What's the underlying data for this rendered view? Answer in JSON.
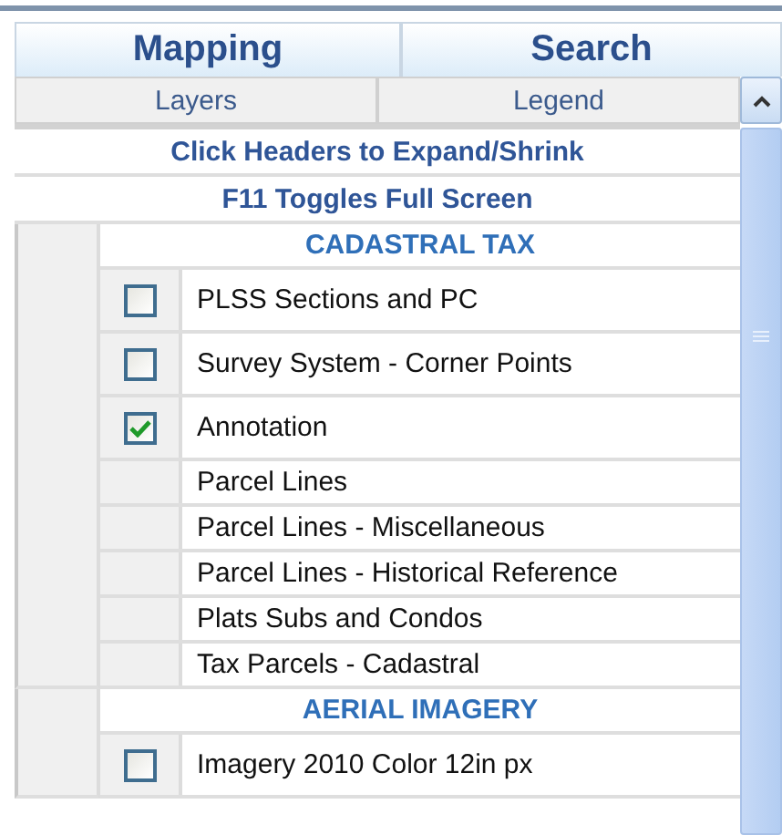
{
  "main_tabs": [
    {
      "label": "Mapping"
    },
    {
      "label": "Search"
    }
  ],
  "sub_tabs": [
    {
      "label": "Layers"
    },
    {
      "label": "Legend"
    }
  ],
  "notes": [
    "Click Headers to Expand/Shrink",
    "F11 Toggles Full Screen"
  ],
  "groups": [
    {
      "title": "CADASTRAL TAX",
      "layers": [
        {
          "name": "PLSS Sections and PC",
          "kind": "checkbox",
          "checked": false
        },
        {
          "name": "Survey System - Corner Points",
          "kind": "checkbox",
          "checked": false
        },
        {
          "name": "Annotation",
          "kind": "checkbox",
          "checked": true
        },
        {
          "name": "Parcel Lines",
          "kind": "plain"
        },
        {
          "name": "Parcel Lines - Miscellaneous",
          "kind": "plain"
        },
        {
          "name": "Parcel Lines - Historical Reference",
          "kind": "plain"
        },
        {
          "name": "Plats Subs and Condos",
          "kind": "plain"
        },
        {
          "name": "Tax Parcels - Cadastral",
          "kind": "plain"
        }
      ]
    },
    {
      "title": "AERIAL IMAGERY",
      "layers": [
        {
          "name": "Imagery 2010 Color 12in px",
          "kind": "checkbox",
          "checked": false
        }
      ]
    }
  ]
}
